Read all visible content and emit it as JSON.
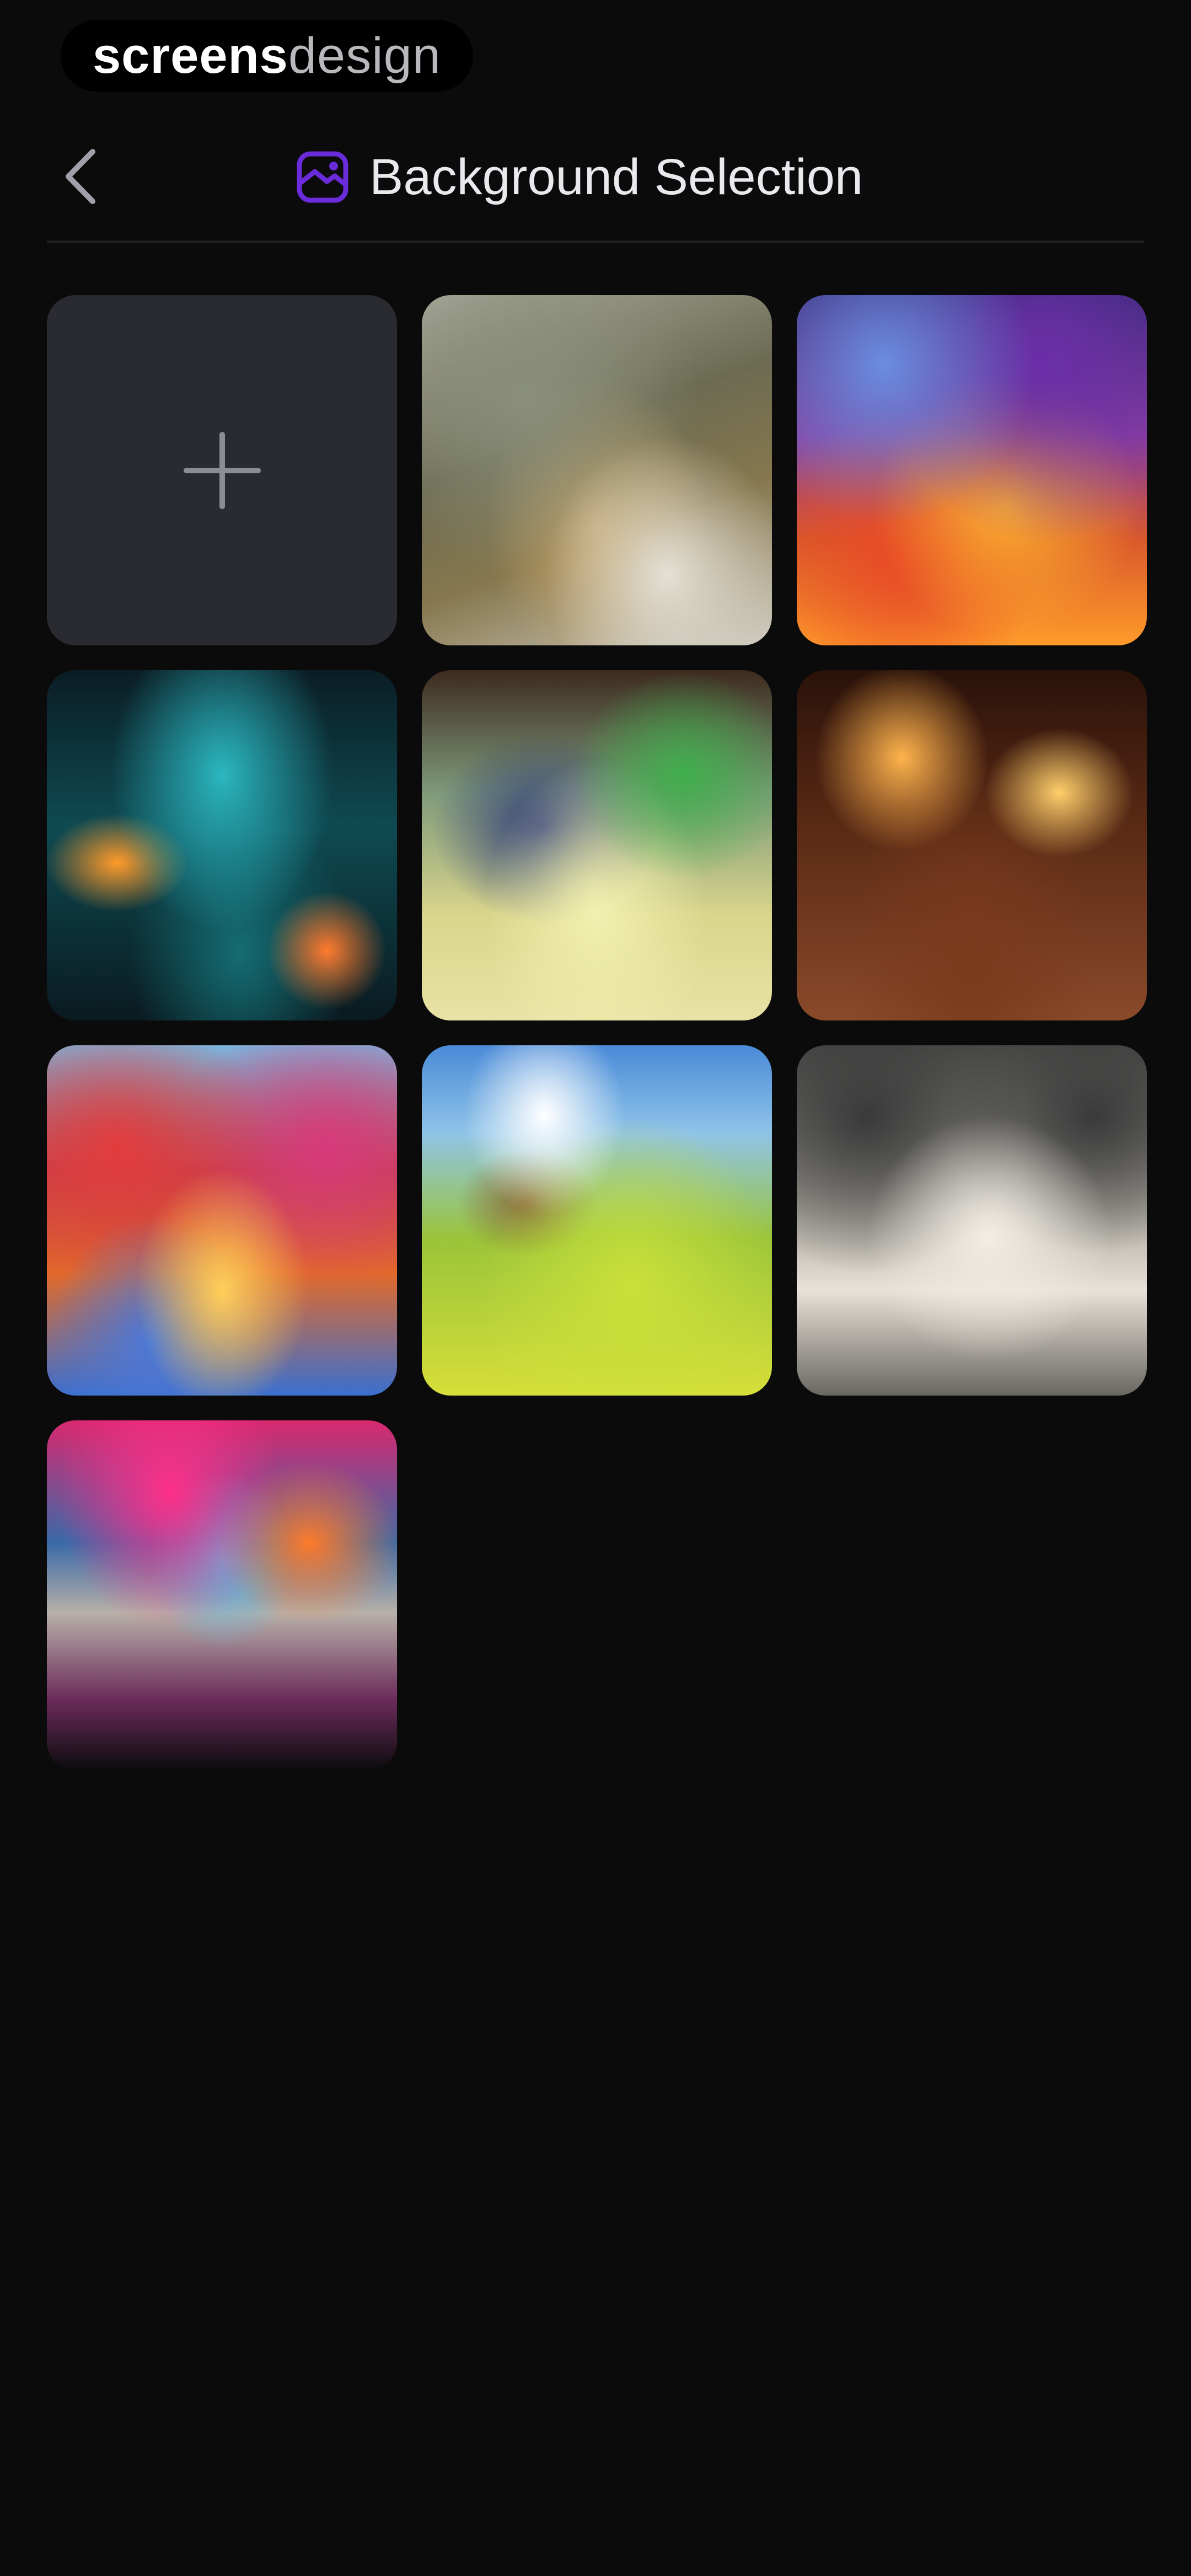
{
  "watermark": {
    "part1": "screens",
    "part2": "design"
  },
  "header": {
    "title": "Background Selection",
    "back_icon": "chevron-left-icon",
    "title_icon": "background-icon",
    "accent_color": "#6a2bd9"
  },
  "grid": {
    "add_icon": "plus-icon",
    "tiles": [
      {
        "name": "background-tile-forest-trail"
      },
      {
        "name": "background-tile-fantasy-sunset"
      },
      {
        "name": "background-tile-neon-street"
      },
      {
        "name": "background-tile-sunny-path"
      },
      {
        "name": "background-tile-night-alley"
      },
      {
        "name": "background-tile-colorful-forest"
      },
      {
        "name": "background-tile-grassy-hills"
      },
      {
        "name": "background-tile-stone-alley"
      },
      {
        "name": "background-tile-graffiti-wall"
      }
    ]
  }
}
